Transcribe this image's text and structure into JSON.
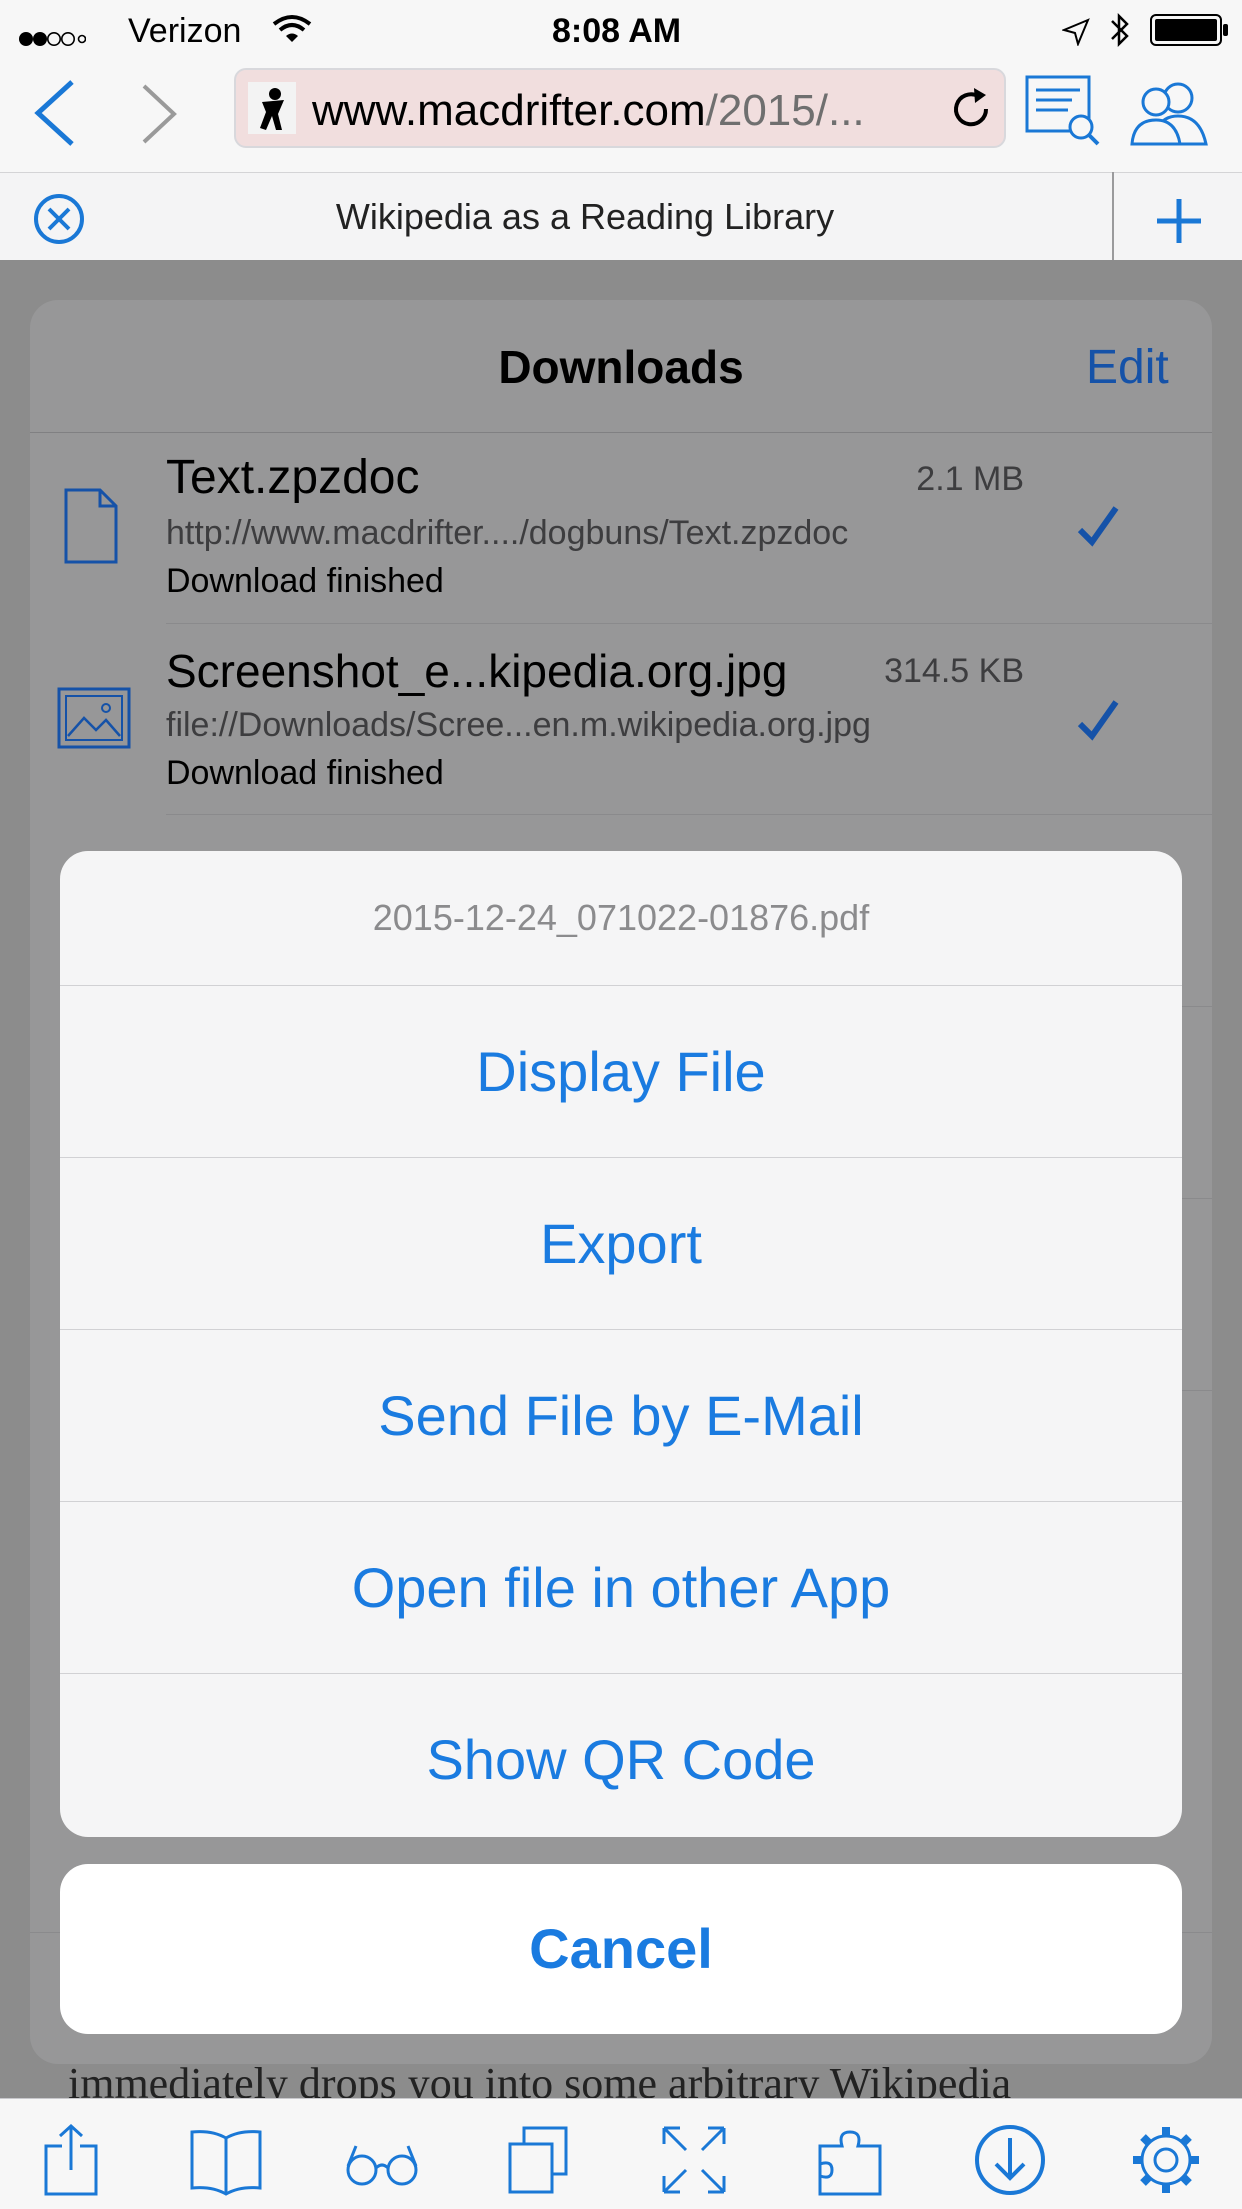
{
  "status": {
    "carrier": "Verizon",
    "time": "8:08 AM"
  },
  "nav": {
    "url_host": "www.macdrifter.com",
    "url_path": "/2015/..."
  },
  "tab": {
    "title": "Wikipedia as a Reading Library"
  },
  "downloads": {
    "title": "Downloads",
    "edit_label": "Edit",
    "items": [
      {
        "name": "Text.zpzdoc",
        "size": "2.1 MB",
        "url": "http://www.macdrifter..../dogbuns/Text.zpzdoc",
        "status": "Download finished"
      },
      {
        "name": "Screenshot_e...kipedia.org.jpg",
        "size": "314.5 KB",
        "url": "file://Downloads/Scree...en.m.wikipedia.org.jpg",
        "status": "Download finished"
      }
    ]
  },
  "action_sheet": {
    "title": "2015-12-24_071022-01876.pdf",
    "options": [
      "Display File",
      "Export",
      "Send File by E-Mail",
      "Open file in other App",
      "Show QR Code"
    ],
    "cancel_label": "Cancel"
  },
  "page": {
    "peek_text": "immediately drops you into some arbitrary Wikipedia"
  },
  "colors": {
    "accent": "#1a7be0",
    "panel": "#979798",
    "sheet": "#f5f5f6"
  }
}
